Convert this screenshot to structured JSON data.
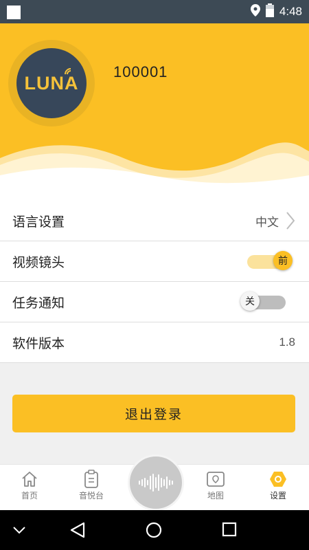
{
  "status_bar": {
    "time": "4:48"
  },
  "profile": {
    "logo_text": "LUNA",
    "user_id": "100001"
  },
  "settings": {
    "language": {
      "label": "语言设置",
      "value": "中文"
    },
    "camera": {
      "label": "视频镜头",
      "toggle_text": "前",
      "on": true
    },
    "notify": {
      "label": "任务通知",
      "toggle_text": "关",
      "on": false
    },
    "version": {
      "label": "软件版本",
      "value": "1.8"
    }
  },
  "logout_label": "退出登录",
  "nav": {
    "home": "首页",
    "music": "音悦台",
    "map": "地图",
    "settings": "设置"
  },
  "colors": {
    "accent": "#fbbf24",
    "avatar_bg": "#37475a",
    "status_bar": "#3d4a55"
  }
}
